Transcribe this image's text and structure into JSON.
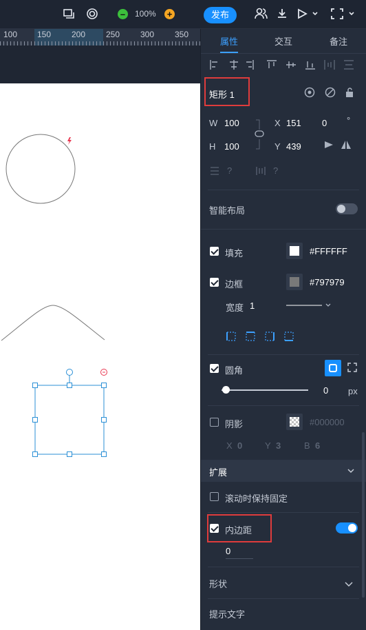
{
  "toolbar": {
    "zoom_level": "100%",
    "publish_label": "发布",
    "icons": [
      "window-icon",
      "target-icon",
      "zoom-out-icon",
      "zoom-in-icon",
      "users-icon",
      "download-icon",
      "play-icon",
      "fullscreen-icon"
    ]
  },
  "ruler": {
    "labels": [
      "100",
      "150",
      "200",
      "250",
      "300",
      "350"
    ]
  },
  "panel": {
    "tabs": [
      "属性",
      "交互",
      "备注"
    ],
    "active_tab": "属性",
    "element_name": "矩形 1",
    "w_label": "W",
    "w_value": "100",
    "h_label": "H",
    "h_value": "100",
    "x_label": "X",
    "x_value": "151",
    "y_label": "Y",
    "y_value": "439",
    "rotation_value": "0",
    "rotation_unit": "°",
    "spacing_q1": "?",
    "spacing_q2": "?",
    "smart_layout_label": "智能布局",
    "fill_label": "填充",
    "fill_value": "#FFFFFF",
    "fill_color": "#FFFFFF",
    "border_label": "边框",
    "border_value": "#797979",
    "border_color": "#797979",
    "width_label": "宽度",
    "width_value": "1",
    "radius_label": "圆角",
    "radius_value": "0",
    "radius_unit": "px",
    "shadow_label": "阴影",
    "shadow_value": "#000000",
    "shadow_x_label": "X",
    "shadow_x_value": "0",
    "shadow_y_label": "Y",
    "shadow_y_value": "3",
    "shadow_b_label": "B",
    "shadow_b_value": "6",
    "extend_label": "扩展",
    "scroll_fixed_label": "滚动时保持固定",
    "padding_label": "内边距",
    "padding_value": "0",
    "shape_label": "形状",
    "tooltip_label": "提示文字"
  },
  "colors": {
    "accent": "#1890ff",
    "selection": "#2a8fd6",
    "highlight": "#e03c3c"
  }
}
